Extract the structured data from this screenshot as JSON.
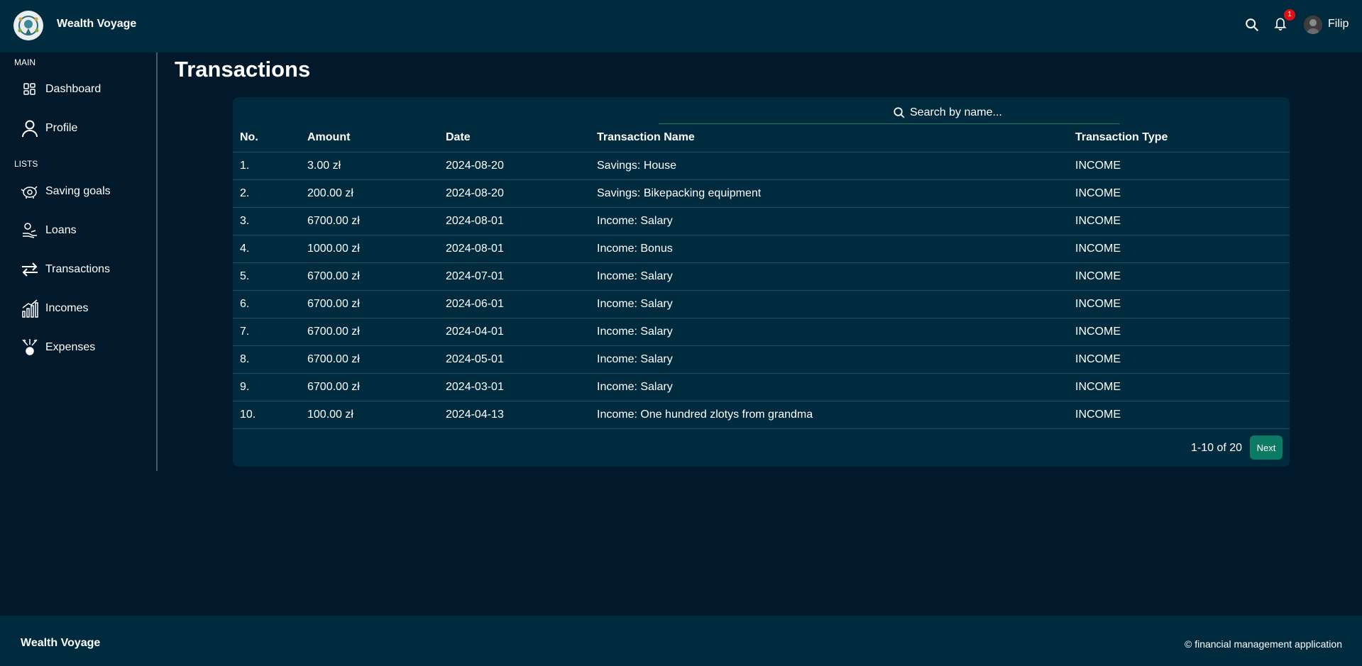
{
  "header": {
    "app_title": "Wealth Voyage",
    "notification_count": "1",
    "user_name": "Filip"
  },
  "sidebar": {
    "sections": [
      {
        "label": "MAIN"
      },
      {
        "label": "LISTS"
      }
    ],
    "items": [
      {
        "label": "Dashboard",
        "icon": "dashboard-icon"
      },
      {
        "label": "Profile",
        "icon": "user-icon"
      },
      {
        "label": "Saving goals",
        "icon": "piggy-bank-icon"
      },
      {
        "label": "Loans",
        "icon": "loan-icon"
      },
      {
        "label": "Transactions",
        "icon": "transfer-arrows-icon"
      },
      {
        "label": "Incomes",
        "icon": "growth-chart-icon"
      },
      {
        "label": "Expenses",
        "icon": "expense-icon"
      }
    ]
  },
  "main": {
    "page_title": "Transactions",
    "search": {
      "placeholder": "Search by name...",
      "value": ""
    },
    "table": {
      "columns": [
        "No.",
        "Amount",
        "Date",
        "Transaction Name",
        "Transaction Type"
      ],
      "rows": [
        [
          "1.",
          "3.00 zł",
          "2024-08-20",
          "Savings: House",
          "INCOME"
        ],
        [
          "2.",
          "200.00 zł",
          "2024-08-20",
          "Savings: Bikepacking equipment",
          "INCOME"
        ],
        [
          "3.",
          "6700.00 zł",
          "2024-08-01",
          "Income: Salary",
          "INCOME"
        ],
        [
          "4.",
          "1000.00 zł",
          "2024-08-01",
          "Income: Bonus",
          "INCOME"
        ],
        [
          "5.",
          "6700.00 zł",
          "2024-07-01",
          "Income: Salary",
          "INCOME"
        ],
        [
          "6.",
          "6700.00 zł",
          "2024-06-01",
          "Income: Salary",
          "INCOME"
        ],
        [
          "7.",
          "6700.00 zł",
          "2024-04-01",
          "Income: Salary",
          "INCOME"
        ],
        [
          "8.",
          "6700.00 zł",
          "2024-05-01",
          "Income: Salary",
          "INCOME"
        ],
        [
          "9.",
          "6700.00 zł",
          "2024-03-01",
          "Income: Salary",
          "INCOME"
        ],
        [
          "10.",
          "100.00 zł",
          "2024-04-13",
          "Income: One hundred zlotys from grandma",
          "INCOME"
        ]
      ]
    },
    "pagination": {
      "range_text": "1-10 of 20",
      "next_label": "Next"
    }
  },
  "footer": {
    "title": "Wealth Voyage",
    "copyright": "© financial management application"
  },
  "colors": {
    "background": "#01192a",
    "panel": "#002b3f",
    "accent": "#0d7a63",
    "badge": "#e01010"
  }
}
